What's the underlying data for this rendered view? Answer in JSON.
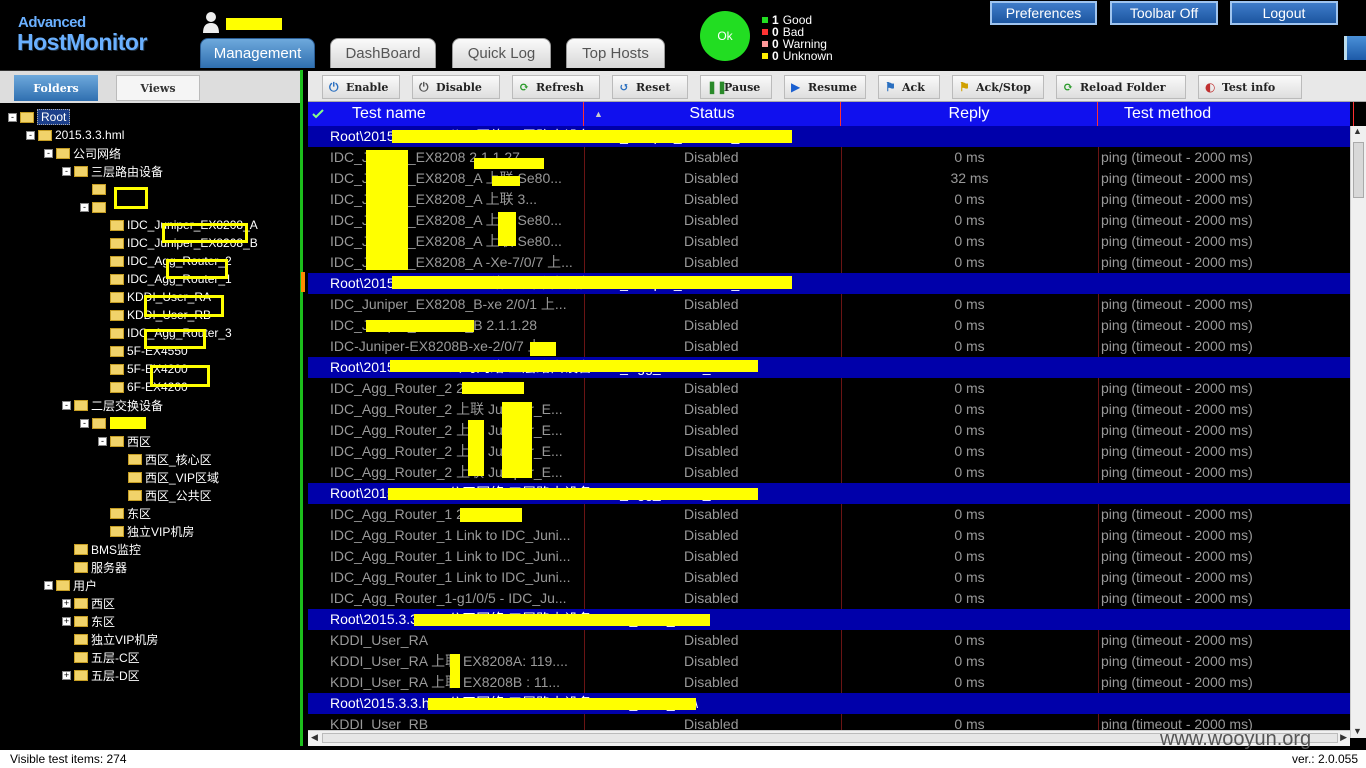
{
  "app": {
    "logo_small": "Advanced",
    "logo_big": "HostMonitor"
  },
  "tabs": [
    {
      "label": "Management"
    },
    {
      "label": "DashBoard"
    },
    {
      "label": "Quick Log"
    },
    {
      "label": "Top Hosts"
    }
  ],
  "status_summary": {
    "ok_label": "Ok",
    "rows": [
      {
        "count": "1",
        "label": "Good",
        "color": "#22dd22"
      },
      {
        "count": "0",
        "label": "Bad",
        "color": "#ff3333"
      },
      {
        "count": "0",
        "label": "Warning",
        "color": "#ff9999"
      },
      {
        "count": "0",
        "label": "Unknown",
        "color": "#ffee00"
      }
    ]
  },
  "top_buttons": {
    "preferences": "Preferences",
    "toolbar_off": "Toolbar Off",
    "logout": "Logout"
  },
  "left_tabs": {
    "folders": "Folders",
    "views": "Views"
  },
  "tree": [
    {
      "label": "Root",
      "exp": "-"
    },
    {
      "label": "2015.3.3.hml",
      "exp": "-"
    },
    {
      "label": "公司网络",
      "exp": "-"
    },
    {
      "label": "三层路由设备",
      "exp": "-"
    },
    {
      "label": "",
      "exp": ""
    },
    {
      "label": "",
      "exp": "-"
    },
    {
      "label": "IDC_Juniper_EX8208_A",
      "exp": ""
    },
    {
      "label": "IDC_Juniper_EX8208_B",
      "exp": ""
    },
    {
      "label": "IDC_Agg_Router_2",
      "exp": ""
    },
    {
      "label": "IDC_Agg_Router_1",
      "exp": ""
    },
    {
      "label": "KDDI_User_RA",
      "exp": ""
    },
    {
      "label": "KDDI_User_RB",
      "exp": ""
    },
    {
      "label": "IDC_Agg_Router_3",
      "exp": ""
    },
    {
      "label": "5F-EX4550",
      "exp": ""
    },
    {
      "label": "5F-EX4200",
      "exp": ""
    },
    {
      "label": "6F-EX4200",
      "exp": ""
    },
    {
      "label": "二层交换设备",
      "exp": "-"
    },
    {
      "label": "",
      "exp": "-"
    },
    {
      "label": "西区",
      "exp": "-"
    },
    {
      "label": "西区_核心区",
      "exp": ""
    },
    {
      "label": "西区_VIP区域",
      "exp": ""
    },
    {
      "label": "西区_公共区",
      "exp": ""
    },
    {
      "label": "东区",
      "exp": ""
    },
    {
      "label": "独立VIP机房",
      "exp": ""
    },
    {
      "label": "BMS监控",
      "exp": ""
    },
    {
      "label": "服务器",
      "exp": ""
    },
    {
      "label": "用户",
      "exp": "-"
    },
    {
      "label": "西区",
      "exp": "+"
    },
    {
      "label": "东区",
      "exp": "+"
    },
    {
      "label": "独立VIP机房",
      "exp": ""
    },
    {
      "label": "五层-C区",
      "exp": ""
    },
    {
      "label": "五层-D区",
      "exp": "+"
    }
  ],
  "toolbar": [
    {
      "label": "Enable",
      "icon": "power-icon"
    },
    {
      "label": "Disable",
      "icon": "power-off-icon"
    },
    {
      "label": "Refresh",
      "icon": "refresh-icon"
    },
    {
      "label": "Reset",
      "icon": "reset-icon"
    },
    {
      "label": "Pause",
      "icon": "pause-icon"
    },
    {
      "label": "Resume",
      "icon": "play-icon"
    },
    {
      "label": "Ack",
      "icon": "flag-icon"
    },
    {
      "label": "Ack/Stop",
      "icon": "flag-stop-icon"
    },
    {
      "label": "Reload Folder",
      "icon": "reload-icon"
    },
    {
      "label": "Test info",
      "icon": "info-icon"
    }
  ],
  "grid": {
    "headers": {
      "name": "Test name",
      "status": "Status",
      "reply": "Reply",
      "method": "Test method"
    },
    "rows": [
      {
        "type": "folder",
        "name": "Root\\2015.3.3.hml\\公司网络\\三层路由设备\\IDC_Juniper_EX8208_A\\"
      },
      {
        "type": "test",
        "name": "IDC_Juniper_EX8208 2.1.1.27",
        "status": "Disabled",
        "reply": "0 ms",
        "method": "ping (timeout - 2000 ms)"
      },
      {
        "type": "test",
        "name": "IDC_Juniper_EX8208_A 上联 Se80...",
        "status": "Disabled",
        "reply": "32 ms",
        "method": "ping (timeout - 2000 ms)"
      },
      {
        "type": "test",
        "name": "IDC_Juniper_EX8208_A 上联 3...",
        "status": "Disabled",
        "reply": "0 ms",
        "method": "ping (timeout - 2000 ms)"
      },
      {
        "type": "test",
        "name": "IDC_Juniper_EX8208_A 上联 Se80...",
        "status": "Disabled",
        "reply": "0 ms",
        "method": "ping (timeout - 2000 ms)"
      },
      {
        "type": "test",
        "name": "IDC_Juniper_EX8208_A 上联 Se80...",
        "status": "Disabled",
        "reply": "0 ms",
        "method": "ping (timeout - 2000 ms)"
      },
      {
        "type": "test",
        "name": "IDC_Juniper_EX8208_A -Xe-7/0/7 上...",
        "status": "Disabled",
        "reply": "0 ms",
        "method": "ping (timeout - 2000 ms)"
      },
      {
        "type": "folder",
        "name": "Root\\2015.3.3.hml\\公司网络\\三层路由设备\\IDC_Juniper_EX8208_B\\"
      },
      {
        "type": "test",
        "name": "IDC_Juniper_EX8208_B-xe 2/0/1 上...",
        "status": "Disabled",
        "reply": "0 ms",
        "method": "ping (timeout - 2000 ms)"
      },
      {
        "type": "test",
        "name": "IDC_Juniper_EX8208_B 2.1.1.28",
        "status": "Disabled",
        "reply": "0 ms",
        "method": "ping (timeout - 2000 ms)"
      },
      {
        "type": "test",
        "name": "IDC-Juniper-EX8208B-xe-2/0/7 上...",
        "status": "Disabled",
        "reply": "0 ms",
        "method": "ping (timeout - 2000 ms)"
      },
      {
        "type": "folder",
        "name": "Root\\2015.3.3.hml\\公司网络\\三层路由设备\\IDC_Agg_Router_2\\"
      },
      {
        "type": "test",
        "name": "IDC_Agg_Router_2 2.1.1.66",
        "status": "Disabled",
        "reply": "0 ms",
        "method": "ping (timeout - 2000 ms)"
      },
      {
        "type": "test",
        "name": "IDC_Agg_Router_2 上联 Juniper_E...",
        "status": "Disabled",
        "reply": "0 ms",
        "method": "ping (timeout - 2000 ms)"
      },
      {
        "type": "test",
        "name": "IDC_Agg_Router_2 上联 Juniper_E...",
        "status": "Disabled",
        "reply": "0 ms",
        "method": "ping (timeout - 2000 ms)"
      },
      {
        "type": "test",
        "name": "IDC_Agg_Router_2 上联 Juniper_E...",
        "status": "Disabled",
        "reply": "0 ms",
        "method": "ping (timeout - 2000 ms)"
      },
      {
        "type": "test",
        "name": "IDC_Agg_Router_2 上联 Juniper_E...",
        "status": "Disabled",
        "reply": "0 ms",
        "method": "ping (timeout - 2000 ms)"
      },
      {
        "type": "folder",
        "name": "Root\\2015.3.3.hml\\公司网络\\三层路由设备\\IDC_Agg_Router_1\\"
      },
      {
        "type": "test",
        "name": "IDC_Agg_Router_1 2.1.1.64",
        "status": "Disabled",
        "reply": "0 ms",
        "method": "ping (timeout - 2000 ms)"
      },
      {
        "type": "test",
        "name": "IDC_Agg_Router_1 Link to IDC_Juni...",
        "status": "Disabled",
        "reply": "0 ms",
        "method": "ping (timeout - 2000 ms)"
      },
      {
        "type": "test",
        "name": "IDC_Agg_Router_1 Link to IDC_Juni...",
        "status": "Disabled",
        "reply": "0 ms",
        "method": "ping (timeout - 2000 ms)"
      },
      {
        "type": "test",
        "name": "IDC_Agg_Router_1 Link to IDC_Juni...",
        "status": "Disabled",
        "reply": "0 ms",
        "method": "ping (timeout - 2000 ms)"
      },
      {
        "type": "test",
        "name": "IDC_Agg_Router_1-g1/0/5 - IDC_Ju...",
        "status": "Disabled",
        "reply": "0 ms",
        "method": "ping (timeout - 2000 ms)"
      },
      {
        "type": "folder",
        "name": "Root\\2015.3.3.hml\\公司网络\\三层路由设备\\KDDI_User_RA\\"
      },
      {
        "type": "test",
        "name": "KDDI_User_RA",
        "status": "Disabled",
        "reply": "0 ms",
        "method": "ping (timeout - 2000 ms)"
      },
      {
        "type": "test",
        "name": "KDDI_User_RA 上联 EX8208A: 119....",
        "status": "Disabled",
        "reply": "0 ms",
        "method": "ping (timeout - 2000 ms)"
      },
      {
        "type": "test",
        "name": "KDDI_User_RA 上联 EX8208B : 11...",
        "status": "Disabled",
        "reply": "0 ms",
        "method": "ping (timeout - 2000 ms)"
      },
      {
        "type": "folder",
        "name": "Root\\2015.3.3.hml\\公司网络\\三层路由设备\\KDDI_User_RB\\"
      },
      {
        "type": "test",
        "name": "KDDI_User_RB",
        "status": "Disabled",
        "reply": "0 ms",
        "method": "ping (timeout - 2000 ms)"
      }
    ]
  },
  "statusbar": {
    "visible_items": "Visible test items: 274",
    "version": "ver.: 2.0.055"
  },
  "watermark": "www.wooyun.org"
}
